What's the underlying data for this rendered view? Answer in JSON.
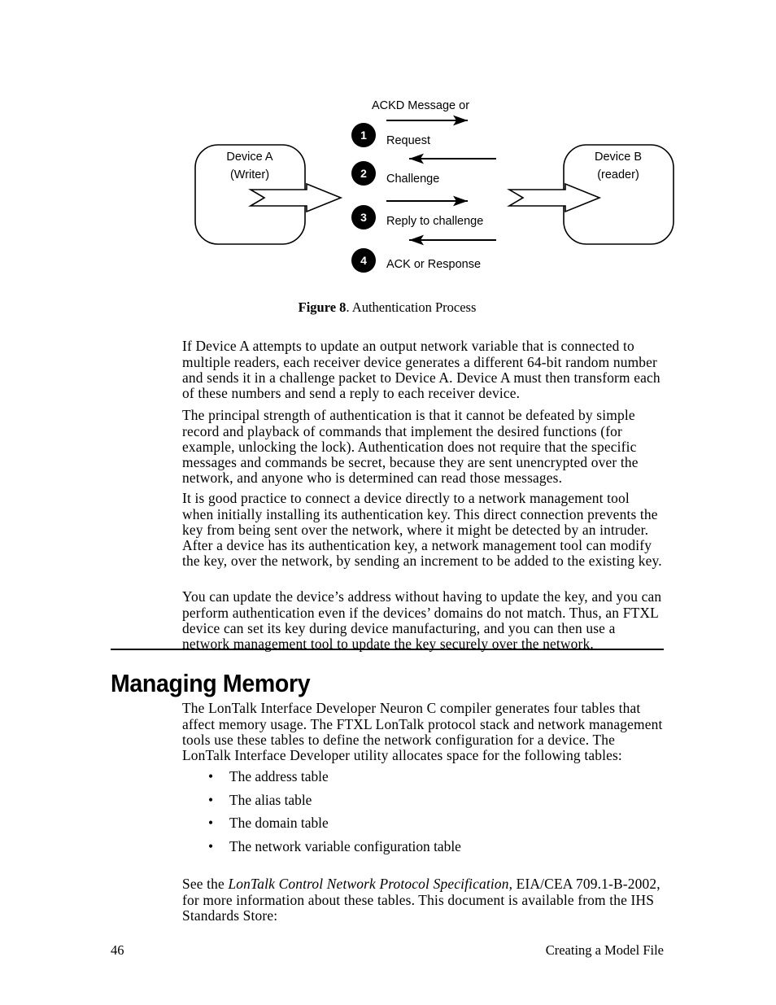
{
  "document": {
    "page_number": "46",
    "footer_section": "Creating a Model File"
  },
  "figure": {
    "caption_label": "Figure 8",
    "caption_text": ". Authentication Process",
    "header_note": "ACKD Message or",
    "device_a": {
      "line1": "Device A",
      "line2": "(Writer)"
    },
    "device_b": {
      "line1": "Device B",
      "line2": "(reader)"
    },
    "steps": [
      {
        "number": "1",
        "label": "Request",
        "direction": "right"
      },
      {
        "number": "2",
        "label": "Challenge",
        "direction": "left"
      },
      {
        "number": "3",
        "label": "Reply to challenge",
        "direction": "right"
      },
      {
        "number": "4",
        "label": "ACK or Response",
        "direction": "left"
      }
    ]
  },
  "body": {
    "para1": "If Device A attempts to update an output network variable that is connected to multiple readers, each receiver device generates a different 64-bit random number and sends it in a challenge packet to Device A.  Device A must then transform each of these numbers and send a reply to each receiver device.",
    "para2": "The principal strength of authentication is that it cannot be defeated by simple record and playback of commands that implement the desired functions (for example, unlocking the lock).  Authentication does not require that the specific messages and commands be secret, because they are sent unencrypted over the network, and anyone who is determined can read those messages.",
    "para3": "It is good practice to connect a device directly to a network management tool when initially installing its authentication key.  This direct connection prevents the key from being sent over the network, where it might be detected by an intruder.  After a device has its authentication key, a network management tool can modify the key, over the network, by sending an increment to be added to the existing key.",
    "para4": "You can update the device’s address without having to update the key, and you can perform authentication even if the devices’ domains do not match.  Thus, an FTXL device can set its key during device manufacturing, and you can then use a network management tool to update the key securely over the network."
  },
  "section": {
    "heading": "Managing Memory",
    "intro_para": "The LonTalk Interface Developer Neuron C compiler generates four tables that affect memory usage.  The FTXL LonTalk protocol stack and network management tools use these tables to define the network configuration for a device.  The LonTalk Interface Developer utility allocates space for the following tables:",
    "bullets": [
      "The address table",
      "The alias table",
      "The domain table",
      "The network variable configuration table"
    ],
    "bullet_glyph": "•",
    "closing_prefix": "See the ",
    "closing_italic": "LonTalk Control Network Protocol Specification",
    "closing_suffix": ", EIA/CEA 709.1-B-2002, for more information about these tables.  This document is available from the IHS Standards Store:"
  },
  "colors": {
    "ink": "#000000",
    "page": "#ffffff",
    "circle_fill": "#000000",
    "circle_text": "#ffffff"
  }
}
